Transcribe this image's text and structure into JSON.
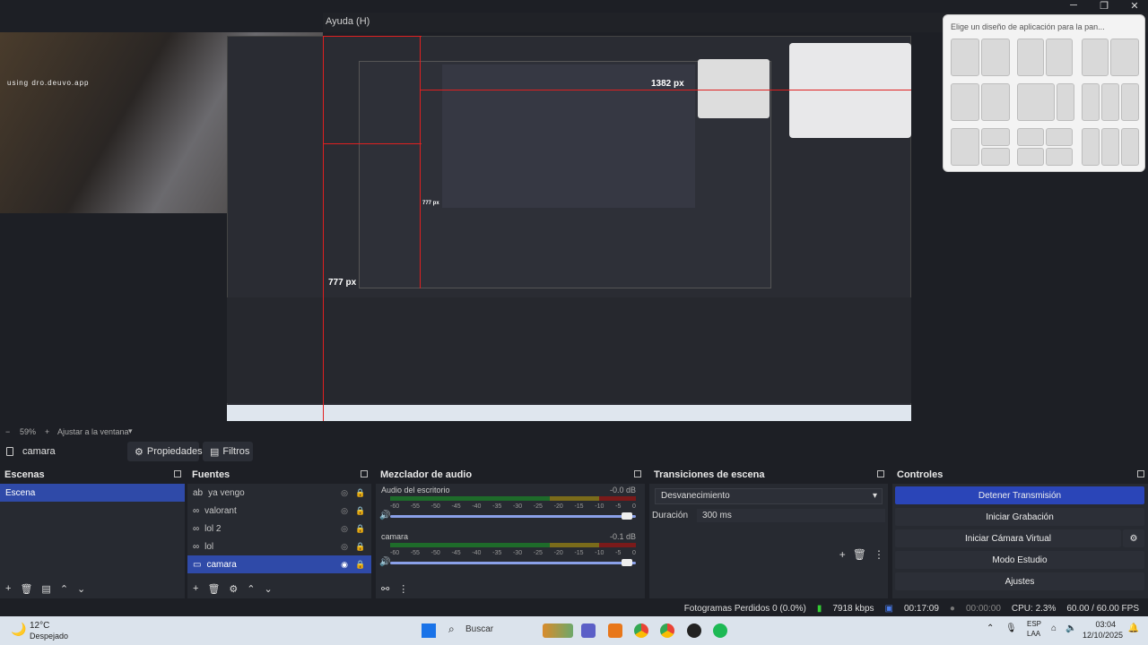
{
  "window": {
    "menu_help": "Ayuda (H)",
    "minimize": "─",
    "maximize": "❐",
    "close": "✕"
  },
  "preview": {
    "webcam_overlay_text": "using dro.deuvo.app",
    "nested_px_label_1": "1382 px",
    "nested_px_label_2": "777 px",
    "nested_px_label_3": "777 px"
  },
  "snap_popup": {
    "title": "Elige un diseño de aplicación para la pan..."
  },
  "zoom": {
    "minus": "−",
    "level": "59%",
    "fit_label": "Ajustar a la ventana"
  },
  "scene_bar": {
    "current_scene": "camara",
    "properties_label": "Propiedades",
    "filters_label": "Filtros"
  },
  "docks": {
    "scenes": {
      "title": "Escenas",
      "items": [
        "Escena"
      ]
    },
    "sources": {
      "title": "Fuentes",
      "items": [
        {
          "type_icon": "ab",
          "label": "ya vengo"
        },
        {
          "type_icon": "∞",
          "label": "valorant"
        },
        {
          "type_icon": "∞",
          "label": "lol 2"
        },
        {
          "type_icon": "∞",
          "label": "lol"
        },
        {
          "type_icon": "▭",
          "label": "camara"
        }
      ]
    },
    "mixer": {
      "title": "Mezclador de audio",
      "channels": [
        {
          "name": "Audio del escritorio",
          "db": "-0.0 dB"
        },
        {
          "name": "camara",
          "db": "-0.1 dB"
        }
      ],
      "ticks": [
        "-60",
        "-55",
        "-50",
        "-45",
        "-40",
        "-35",
        "-30",
        "-25",
        "-20",
        "-15",
        "-10",
        "-5",
        "0"
      ]
    },
    "transitions": {
      "title": "Transiciones de escena",
      "selected": "Desvanecimiento",
      "duration_label": "Duración",
      "duration_value": "300 ms"
    },
    "controls": {
      "title": "Controles",
      "buttons": [
        "Detener Transmisión",
        "Iniciar Grabación",
        "Iniciar Cámara Virtual",
        "Modo Estudio",
        "Ajustes"
      ]
    }
  },
  "status": {
    "dropped_frames": "Fotogramas Perdidos 0 (0.0%)",
    "bitrate": "7918 kbps",
    "stream_time": "00:17:09",
    "rec_time": "00:00:00",
    "cpu": "CPU: 2.3%",
    "fps": "60.00 / 60.00 FPS"
  },
  "taskbar": {
    "weather_temp": "12°C",
    "weather_desc": "Despejado",
    "search_placeholder": "Buscar",
    "lang_top": "ESP",
    "lang_bottom": "LAA",
    "time": "03:04",
    "date": "12/10/2025"
  },
  "colors": {
    "accent": "#2f4aa8",
    "primary_button": "#2a45b8",
    "panel": "#272a31",
    "background": "#1d1f25"
  }
}
